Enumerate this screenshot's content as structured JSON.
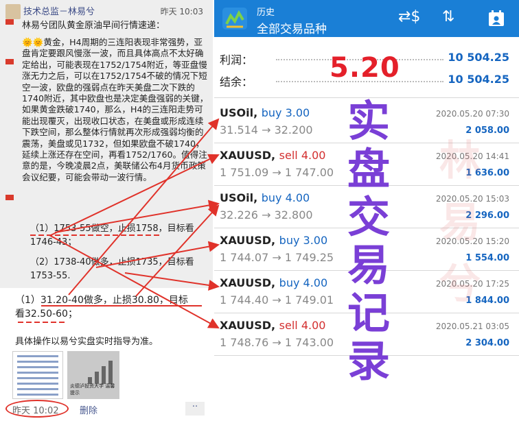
{
  "post": {
    "author": "技术总监－林易兮",
    "time": "昨天 10:03",
    "intro": "林易兮团队黄金原油早间行情速递：",
    "body": "🌞🌞黄金，H4周期的三连阳表现非常强势，亚盘肯定要跟风慢涨一波，而且具体高点不太好确定给出，可能表现在1752/1754附近，等亚盘慢涨无力之后，可以在1752/1754不破的情况下短空一波，欧盘的强弱点在昨天美盘二次下跌的1740附近，其中欧盘也是决定美盘强弱的关键，如果黄金跌破1740，那么，H4的三连阳走势可能出现覆灭，出现收口状态，在美盘或形成连续下跌空间，那么整体行情就再次形成强弱均衡的震荡，美盘或见1732，但如果欧盘不破1740，延续上涨还存在空间，再看1752/1760。值得注意的是，今晚凌晨2点，美联储公布4月货币政策会议纪要，可能会带动一波行情。",
    "plan1_a": "（1）1753-55做空，止损1758，目标看",
    "plan1_b": "1746-43；",
    "plan2_a": "（2）1738-40做多，止损1735，目标看",
    "plan2_b": "1753-55.",
    "plan3_a": "（1）31.20-40做多，止损30.80，目标",
    "plan3_b": "看32.50-60；",
    "note": "具体操作以易兮实盘实时指导为准。",
    "thumb_caption": "炎德泸投资大学 温馨提示",
    "footer_time": "昨天 10:02",
    "delete_label": "删除",
    "more_label": "··"
  },
  "app": {
    "header_small": "历史",
    "header_title": "全部交易品种",
    "profit_label": "利润：",
    "profit_value": "10 504.25",
    "balance_label": "结余：",
    "balance_value": "10 504.25"
  },
  "trades": [
    {
      "symbol": "USOil,",
      "side": "buy",
      "volume": "buy 3.00",
      "prices": "31.514 → 32.200",
      "date": "2020.05.20 07:30",
      "profit": "2 058.00"
    },
    {
      "symbol": "XAUUSD,",
      "side": "sell",
      "volume": "sell 4.00",
      "prices": "1 751.09 → 1 747.00",
      "date": "2020.05.20 14:41",
      "profit": "1 636.00"
    },
    {
      "symbol": "USOil,",
      "side": "buy",
      "volume": "buy 4.00",
      "prices": "32.226 → 32.800",
      "date": "2020.05.20 15:03",
      "profit": "2 296.00"
    },
    {
      "symbol": "XAUUSD,",
      "side": "buy",
      "volume": "buy 3.00",
      "prices": "1 744.07 → 1 749.25",
      "date": "2020.05.20 15:20",
      "profit": "1 554.00"
    },
    {
      "symbol": "XAUUSD,",
      "side": "buy",
      "volume": "buy 4.00",
      "prices": "1 744.40 → 1 749.01",
      "date": "2020.05.20 17:25",
      "profit": "1 844.00"
    },
    {
      "symbol": "XAUUSD,",
      "side": "sell",
      "volume": "sell 4.00",
      "prices": "1 748.76 → 1 743.00",
      "date": "2020.05.21 03:05",
      "profit": "2 304.00"
    }
  ],
  "overlay": {
    "date": "5.20",
    "chars": [
      "实",
      "盘",
      "交",
      "易",
      "记",
      "录"
    ],
    "watermark": [
      "林",
      "易",
      "兮"
    ]
  },
  "colors": {
    "header": "#1a7fd6",
    "buy": "#1565c0",
    "sell": "#d32f2f",
    "overlay_purple": "#7a3fd6",
    "overlay_red": "#e4202a",
    "annotation": "#e0322a"
  }
}
